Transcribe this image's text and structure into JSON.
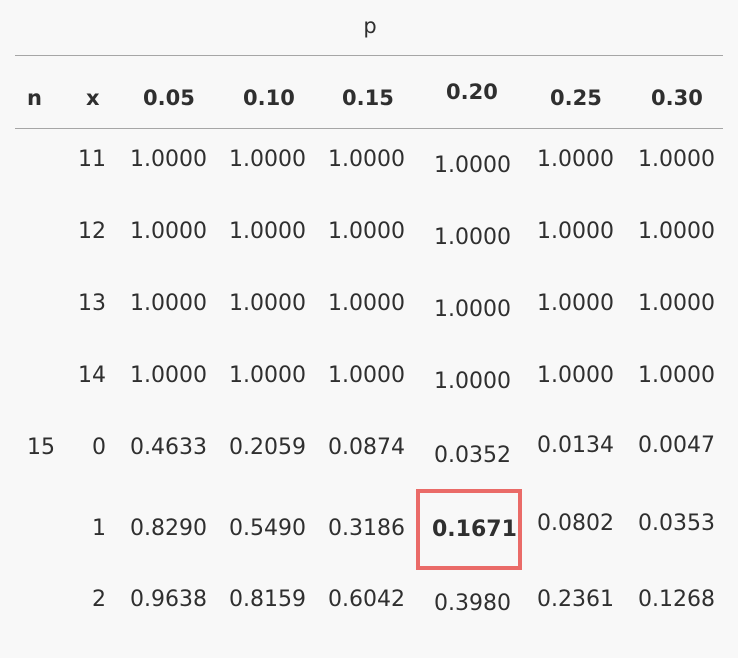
{
  "table": {
    "p_label": "p",
    "headers": {
      "n": "n",
      "x": "x",
      "p005": "0.05",
      "p010": "0.10",
      "p015": "0.15",
      "p020": "0.20",
      "p025": "0.25",
      "p030": "0.30"
    },
    "rows": [
      {
        "n": "",
        "x": "11",
        "p005": "1.0000",
        "p010": "1.0000",
        "p015": "1.0000",
        "p020": "1.0000",
        "p025": "1.0000",
        "p030": "1.0000"
      },
      {
        "n": "",
        "x": "12",
        "p005": "1.0000",
        "p010": "1.0000",
        "p015": "1.0000",
        "p020": "1.0000",
        "p025": "1.0000",
        "p030": "1.0000"
      },
      {
        "n": "",
        "x": "13",
        "p005": "1.0000",
        "p010": "1.0000",
        "p015": "1.0000",
        "p020": "1.0000",
        "p025": "1.0000",
        "p030": "1.0000"
      },
      {
        "n": "",
        "x": "14",
        "p005": "1.0000",
        "p010": "1.0000",
        "p015": "1.0000",
        "p020": "1.0000",
        "p025": "1.0000",
        "p030": "1.0000"
      },
      {
        "n": "15",
        "x": "0",
        "p005": "0.4633",
        "p010": "0.2059",
        "p015": "0.0874",
        "p020": "0.0352",
        "p025": "0.0134",
        "p030": "0.0047"
      },
      {
        "n": "",
        "x": "1",
        "p005": "0.8290",
        "p010": "0.5490",
        "p015": "0.3186",
        "p020": "0.1671",
        "p025": "0.0802",
        "p030": "0.0353"
      },
      {
        "n": "",
        "x": "2",
        "p005": "0.9638",
        "p010": "0.8159",
        "p015": "0.6042",
        "p020": "0.3980",
        "p025": "0.2361",
        "p030": "0.1268"
      }
    ],
    "highlight": {
      "value": "0.1671",
      "border_color": "#ea6b68"
    }
  }
}
